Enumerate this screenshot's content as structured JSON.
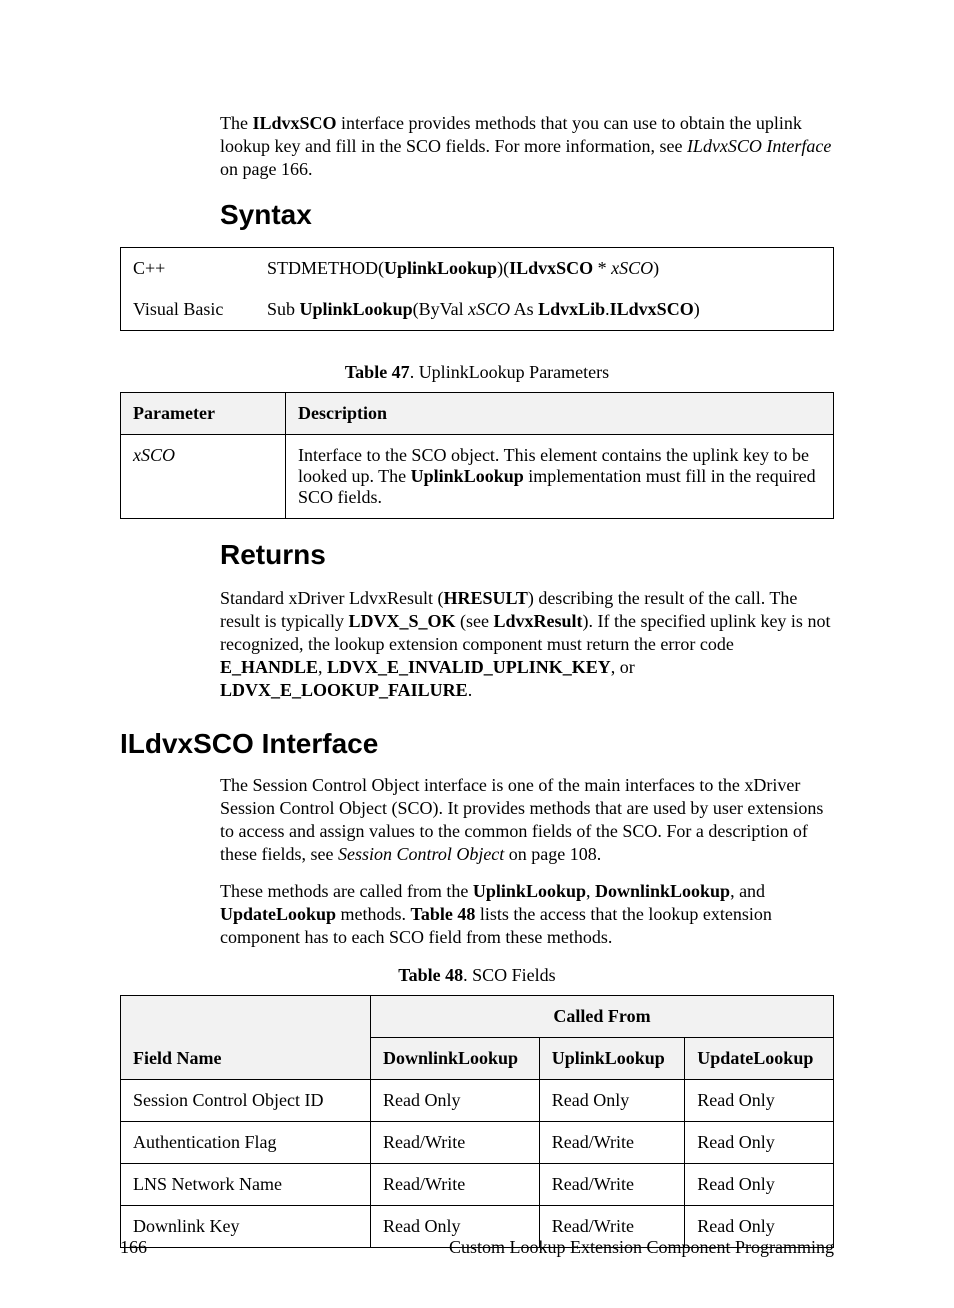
{
  "intro": {
    "text_pre": "The ",
    "bold1": "ILdvxSCO",
    "text_mid": " interface provides methods that you can use to obtain the uplink lookup key and fill in the SCO fields.  For more information, see ",
    "ital": "ILdvxSCO Interface",
    "text_post": " on page 166."
  },
  "headings": {
    "syntax": "Syntax",
    "returns": "Returns",
    "iface": "ILdvxSCO Interface"
  },
  "syntax": {
    "cpp_lang": "C++",
    "cpp_pre": "STDMETHOD(",
    "cpp_b1": "UplinkLookup",
    "cpp_mid1": ")(",
    "cpp_b2": "ILdvxSCO",
    "cpp_mid2": " * ",
    "cpp_i": "xSCO",
    "cpp_post": ")",
    "vb_lang": "Visual Basic",
    "vb_pre": "Sub ",
    "vb_b1": "UplinkLookup",
    "vb_mid1": "(ByVal ",
    "vb_i": "xSCO",
    "vb_mid2": " As ",
    "vb_b2": "LdvxLib",
    "vb_dot": ".",
    "vb_b3": "ILdvxSCO",
    "vb_post": ")"
  },
  "table47": {
    "caption_b": "Table 47",
    "caption_rest": ". UplinkLookup Parameters",
    "h1": "Parameter",
    "h2": "Description",
    "row_param": "xSCO",
    "row_desc_pre": "Interface to the SCO object.  This element contains the uplink key to be looked up.  The ",
    "row_desc_b": "UplinkLookup",
    "row_desc_post": " implementation must fill in the required SCO fields."
  },
  "returns": {
    "pre": "Standard xDriver LdvxResult (",
    "b1": "HRESULT",
    "mid1": ") describing the result of the call.  The result is typically ",
    "b2": "LDVX_S_OK",
    "mid2": " (see ",
    "b3": "LdvxResult",
    "mid3": ").  If the specified uplink key is not recognized, the lookup extension component must return the error code ",
    "b4": "E_HANDLE",
    "c1": ", ",
    "b5": "LDVX_E_INVALID_UPLINK_KEY",
    "c2": ", or ",
    "b6": "LDVX_E_LOOKUP_FAILURE",
    "post": "."
  },
  "iface": {
    "p1_pre": "The Session Control Object interface is one of the main interfaces to the xDriver Session Control Object (SCO).  It provides methods that are used by user extensions to access and assign values to the common fields of the SCO.  For a description of these fields, see ",
    "p1_i": "Session Control Object",
    "p1_post": " on page 108.",
    "p2_pre": "These methods are called from the ",
    "p2_b1": "UplinkLookup",
    "p2_c1": ", ",
    "p2_b2": "DownlinkLookup",
    "p2_c2": ", and ",
    "p2_b3": "UpdateLookup",
    "p2_mid": " methods.  ",
    "p2_b4": "Table 48",
    "p2_post": " lists the access that the lookup extension component has to each SCO field from these methods."
  },
  "table48": {
    "caption_b": "Table 48",
    "caption_rest": ". SCO Fields",
    "h_called": "Called From",
    "h_field": "Field Name",
    "h_down": "DownlinkLookup",
    "h_up": "UplinkLookup",
    "h_upd": "UpdateLookup",
    "rows": [
      {
        "f": "Session Control Object ID",
        "d": "Read Only",
        "u": "Read Only",
        "p": "Read Only"
      },
      {
        "f": "Authentication Flag",
        "d": "Read/Write",
        "u": "Read/Write",
        "p": "Read Only"
      },
      {
        "f": "LNS Network Name",
        "d": "Read/Write",
        "u": "Read/Write",
        "p": "Read Only"
      },
      {
        "f": "Downlink Key",
        "d": "Read Only",
        "u": "Read/Write",
        "p": "Read Only"
      }
    ]
  },
  "footer": {
    "page": "166",
    "title": "Custom Lookup Extension Component Programming"
  }
}
